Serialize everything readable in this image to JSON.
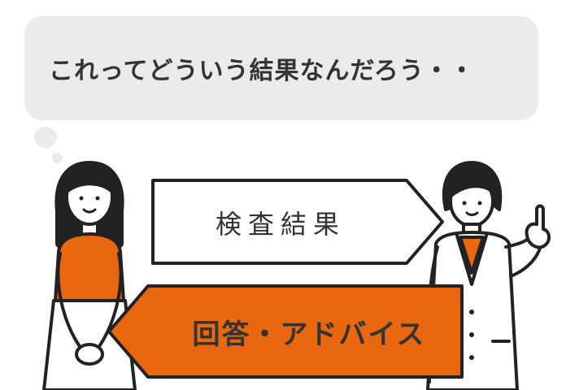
{
  "speech_bubble": {
    "text": "これってどういう結果なんだろう・・"
  },
  "arrows": {
    "results_label": "検査結果",
    "advice_label": "回答・アドバイス"
  },
  "colors": {
    "accent_orange": "#e8670f",
    "bubble_gray": "#ebebeb",
    "outline": "#222222",
    "text_dark": "#333333"
  }
}
